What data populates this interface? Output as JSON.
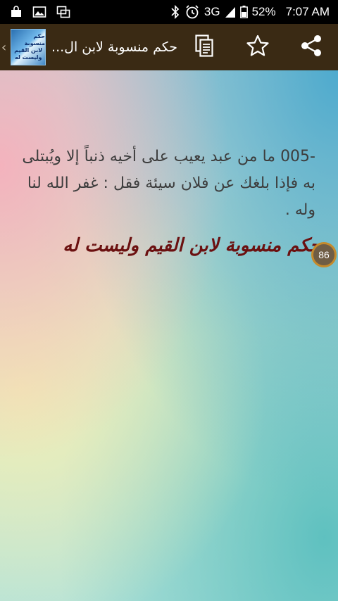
{
  "status_bar": {
    "network": "3G",
    "battery": "52%",
    "time": "7:07 AM",
    "icons": [
      "bag-icon",
      "image-icon",
      "screenshot-icon",
      "bluetooth-icon",
      "alarm-icon",
      "signal-icon",
      "battery-icon"
    ]
  },
  "app_bar": {
    "title": "حكم منسوبة لابن ال...",
    "logo_lines": [
      "حكم منسوبة",
      "لابن القيم",
      "وليست له"
    ],
    "actions": [
      "copy-icon",
      "star-icon",
      "share-icon"
    ]
  },
  "content": {
    "quote_number": "005-",
    "quote_text": "ما من عبد يعيب على أخيه ذنباً إلا ويُبتلى به فإذا بلغك عن فلان سيئة فقل : غفر الله لنا وله .",
    "signature": "حكم منسوبة لابن القيم وليست له",
    "page_badge": "86"
  },
  "colors": {
    "app_bar": "#3a2a14",
    "quote_text": "#3d3d3d",
    "signature": "#6b1010",
    "badge_border": "#c58a2b"
  }
}
